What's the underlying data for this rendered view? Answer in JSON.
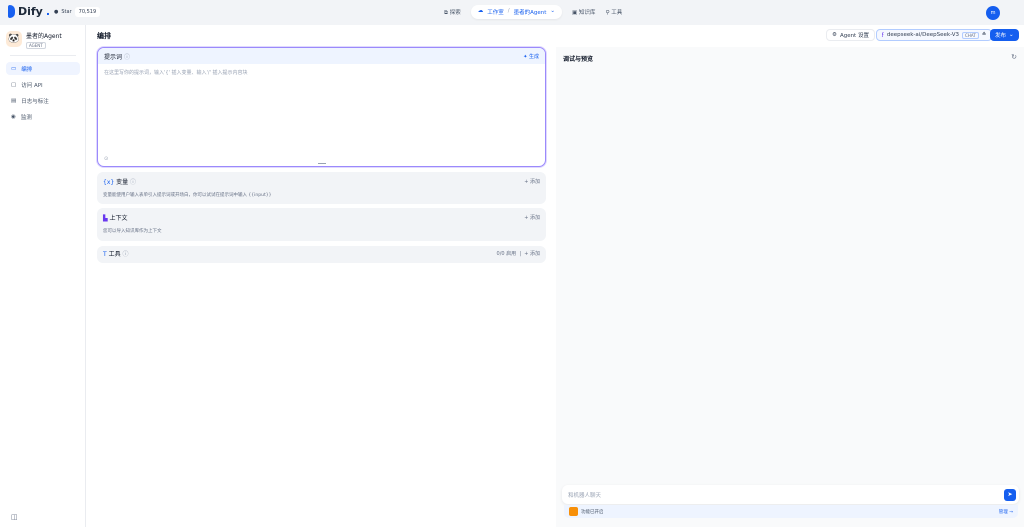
{
  "brand": {
    "name": "Dify",
    "star_label": "Star",
    "star_count": "70,519"
  },
  "nav": {
    "explore": "探索",
    "studio": "工作室",
    "app_name": "墨者的Agent",
    "knowledge": "知识库",
    "tools": "工具"
  },
  "user": {
    "initials": "m"
  },
  "app": {
    "name": "墨者的Agent",
    "type": "AGENT"
  },
  "sidebar": {
    "items": [
      {
        "label": "编排"
      },
      {
        "label": "访问 API"
      },
      {
        "label": "日志与标注"
      },
      {
        "label": "监测"
      }
    ]
  },
  "main": {
    "title": "编排",
    "agent_settings": "Agent 设置",
    "model": "deepseek-ai/DeepSeek-V3",
    "model_tag": "CHAT",
    "publish": "发布",
    "prompt": {
      "title": "提示词",
      "generate": "生成",
      "placeholder": "在这里写你的提示词，输入'{' 插入变量、输入'/' 插入提示内容块"
    },
    "variables": {
      "title": "变量",
      "add": "添加",
      "desc": "变量能使用户输入表单引入提示词或开场白，你可以试试在提示词中输入 {{input}}"
    },
    "context": {
      "title": "上下文",
      "add": "添加",
      "desc": "您可以导入知识库作为上下文"
    },
    "tools": {
      "title": "工具",
      "count": "0/0 启用",
      "add": "添加"
    }
  },
  "preview": {
    "title": "调试与预览",
    "chat_placeholder": "和机器人聊天",
    "features": "功能已开启",
    "manage": "管理"
  }
}
